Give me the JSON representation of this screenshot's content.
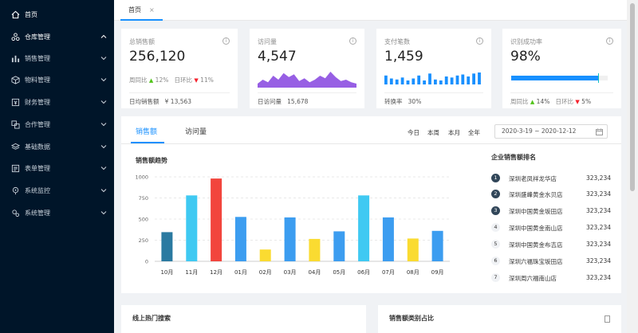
{
  "sidebar": {
    "items": [
      {
        "label": "首页",
        "icon": "home-icon",
        "active": true
      },
      {
        "label": "仓库管理",
        "icon": "cluster-icon",
        "active": true,
        "expanded": true
      },
      {
        "label": "销售管理",
        "icon": "bar-chart-icon"
      },
      {
        "label": "物料管理",
        "icon": "cube-icon"
      },
      {
        "label": "财务管理",
        "icon": "finance-icon"
      },
      {
        "label": "合作管理",
        "icon": "partner-icon"
      },
      {
        "label": "基础数据",
        "icon": "layers-icon"
      },
      {
        "label": "表单管理",
        "icon": "form-icon"
      },
      {
        "label": "系统监控",
        "icon": "monitor-icon"
      },
      {
        "label": "系统管理",
        "icon": "settings-icon"
      }
    ]
  },
  "tabs": {
    "home": "首页",
    "close": "×"
  },
  "kpi": {
    "sales": {
      "title": "总销售额",
      "value": "256,120",
      "wow_label": "周同比",
      "wow_value": "12%",
      "dod_label": "日环比",
      "dod_value": "11%",
      "foot_label": "日均销售额",
      "foot_value": "¥ 13,563"
    },
    "visits": {
      "title": "访问量",
      "value": "4,547",
      "foot_label": "日访问量",
      "foot_value": "15,678"
    },
    "payments": {
      "title": "支付笔数",
      "value": "1,459",
      "foot_label": "转换率",
      "foot_value": "30%"
    },
    "recognition": {
      "title": "识别成功率",
      "value": "98%",
      "progress": 0.9,
      "wow_label": "周同比",
      "wow_value": "14%",
      "dod_label": "日环比",
      "dod_value": "5%"
    }
  },
  "main": {
    "tab_sales": "销售额",
    "tab_visits": "访问量",
    "periods": [
      "今日",
      "本周",
      "本月",
      "全年"
    ],
    "date_range": "2020-3-19 ~ 2020-12-12",
    "chart_title": "销售额趋势",
    "rank_title": "企业销售额排名",
    "ranking": [
      {
        "rank": "1",
        "name": "深圳老凤祥龙华店",
        "value": "323,234"
      },
      {
        "rank": "2",
        "name": "深圳盛峰黄金水贝店",
        "value": "323,234"
      },
      {
        "rank": "3",
        "name": "深圳中国黄金坂田店",
        "value": "323,234"
      },
      {
        "rank": "4",
        "name": "深圳中国黄金南山店",
        "value": "323,234"
      },
      {
        "rank": "5",
        "name": "深圳中国黄金布吉店",
        "value": "323,234"
      },
      {
        "rank": "6",
        "name": "深圳六福珠宝坂田店",
        "value": "323,234"
      },
      {
        "rank": "7",
        "name": "深圳周六福南山店",
        "value": "323,234"
      }
    ]
  },
  "bottom": {
    "hot_search": "线上热门搜索",
    "category_share": "销售额类别占比"
  },
  "chart_data": {
    "type": "bar",
    "categories": [
      "10月",
      "11月",
      "12月",
      "01月",
      "02月",
      "03月",
      "04月",
      "05月",
      "06月",
      "07月",
      "08月",
      "09月"
    ],
    "values": [
      345,
      780,
      980,
      525,
      140,
      520,
      265,
      355,
      780,
      520,
      270,
      360
    ],
    "colors": [
      "#2b7aa1",
      "#3fc9f2",
      "#f2453d",
      "#3c9df0",
      "#fadb31",
      "#3c9df0",
      "#fadb31",
      "#3c9df0",
      "#3fc9f2",
      "#3c9df0",
      "#fadb31",
      "#3c9df0"
    ],
    "yticks": [
      "0",
      "250",
      "500",
      "750",
      "1000"
    ],
    "ylim": [
      0,
      1000
    ]
  },
  "sparkline_visits": [
    3,
    6,
    4,
    9,
    6,
    11,
    8,
    10,
    5,
    7,
    4,
    6,
    9,
    7,
    12,
    8,
    5,
    6,
    4,
    3
  ],
  "bars_payments": [
    9,
    6,
    5,
    7,
    4,
    6,
    9,
    4,
    11,
    5,
    4,
    8,
    7,
    9,
    10,
    8,
    11,
    12
  ],
  "colors": {
    "accent": "#1890ff",
    "sidebar": "#001529",
    "visits_area": "#975fe4"
  }
}
